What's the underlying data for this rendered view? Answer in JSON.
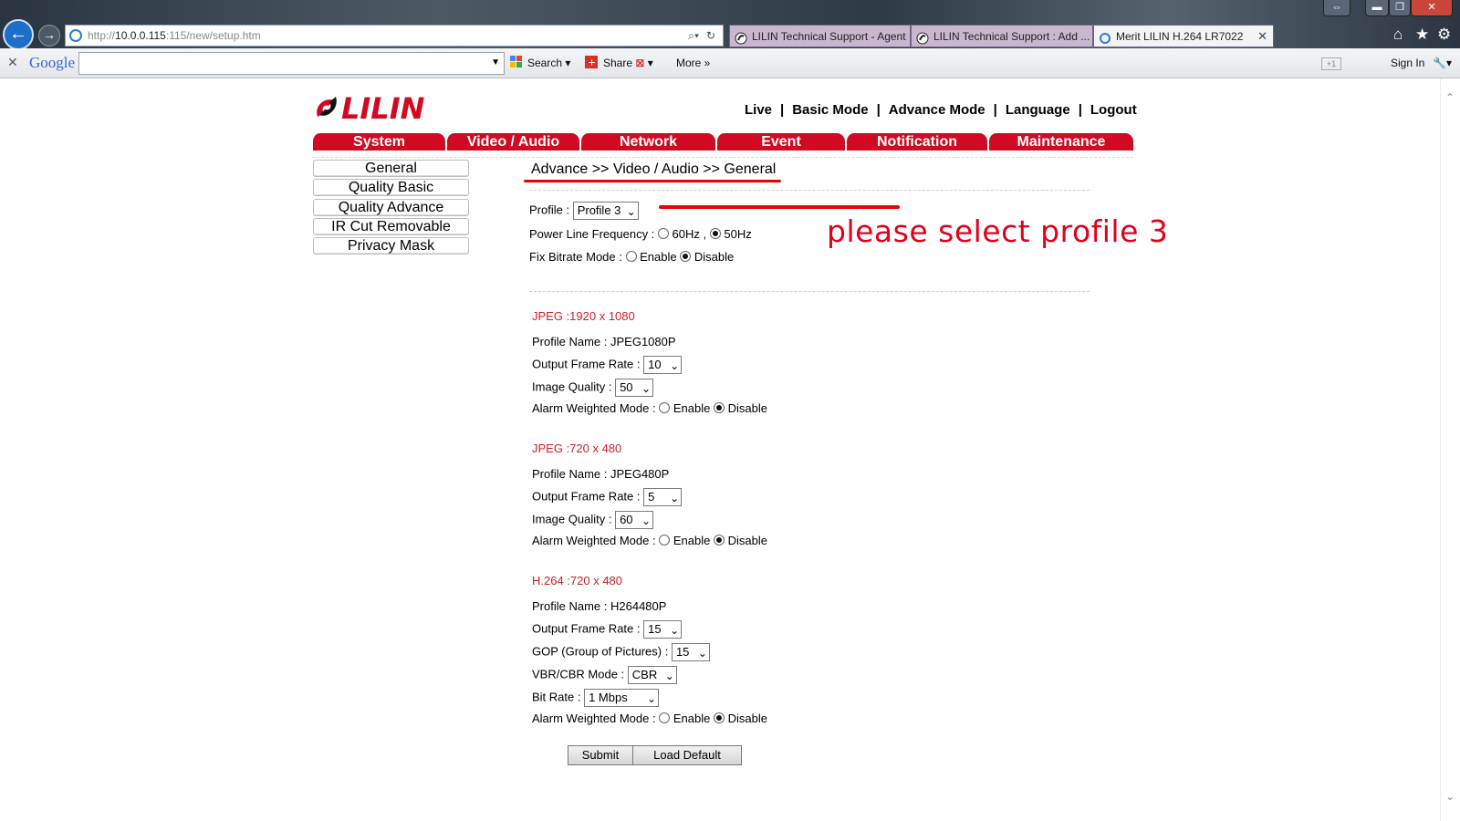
{
  "browser": {
    "address": {
      "prefix": "http://",
      "host": "10.0.0.115",
      "rest": ":115/new/setup.htm"
    },
    "tabs": [
      {
        "label": "LILIN Technical Support - Agent"
      },
      {
        "label": "LILIN Technical Support : Add ..."
      },
      {
        "label": "Merit LILIN H.264 LR7022"
      }
    ],
    "toolbar": {
      "google": "Google",
      "search": "Search",
      "share": "Share",
      "more": "More",
      "sign_in": "Sign In"
    }
  },
  "header": {
    "logo": "LILIN",
    "nav": [
      "Live",
      "Basic Mode",
      "Advance Mode",
      "Language",
      "Logout"
    ]
  },
  "menu": [
    "System",
    "Video / Audio",
    "Network",
    "Event",
    "Notification",
    "Maintenance"
  ],
  "sidebar": [
    "General",
    "Quality Basic",
    "Quality Advance",
    "IR Cut Removable",
    "Privacy Mask"
  ],
  "breadcrumb": "Advance >> Video / Audio >> General",
  "annotation": "please select profile 3",
  "general": {
    "profile_label": "Profile :",
    "profile_value": "Profile 3",
    "power_label": "Power Line Frequency :",
    "power_opt1": "60Hz ,",
    "power_opt2": "50Hz",
    "power_selected": "50Hz",
    "fix_label": "Fix Bitrate Mode :",
    "fix_opt1": "Enable",
    "fix_opt2": "Disable",
    "fix_selected": "Disable"
  },
  "streams": [
    {
      "title": "JPEG :1920 x 1080",
      "profile_name_label": "Profile Name :",
      "profile_name": "JPEG1080P",
      "frame_rate_label": "Output Frame Rate :",
      "frame_rate": "10",
      "quality_label": "Image Quality :",
      "quality": "50",
      "alarm_label": "Alarm Weighted Mode :",
      "alarm_enable": "Enable",
      "alarm_disable": "Disable",
      "alarm_selected": "Disable"
    },
    {
      "title": "JPEG :720 x 480",
      "profile_name_label": "Profile Name :",
      "profile_name": "JPEG480P",
      "frame_rate_label": "Output Frame Rate :",
      "frame_rate": "5",
      "quality_label": "Image Quality :",
      "quality": "60",
      "alarm_label": "Alarm Weighted Mode :",
      "alarm_enable": "Enable",
      "alarm_disable": "Disable",
      "alarm_selected": "Disable"
    },
    {
      "title": "H.264 :720 x 480",
      "profile_name_label": "Profile Name :",
      "profile_name": "H264480P",
      "frame_rate_label": "Output Frame Rate :",
      "frame_rate": "15",
      "gop_label": "GOP (Group of Pictures) :",
      "gop": "15",
      "vbr_label": "VBR/CBR Mode :",
      "vbr": "CBR",
      "bitrate_label": "Bit Rate :",
      "bitrate": "1 Mbps",
      "alarm_label": "Alarm Weighted Mode :",
      "alarm_enable": "Enable",
      "alarm_disable": "Disable",
      "alarm_selected": "Disable"
    }
  ],
  "buttons": {
    "submit": "Submit",
    "load_default": "Load Default"
  },
  "colors": {
    "brand_red": "#d20922",
    "section_red": "#c8202a",
    "annotation_red": "#e2001a"
  }
}
